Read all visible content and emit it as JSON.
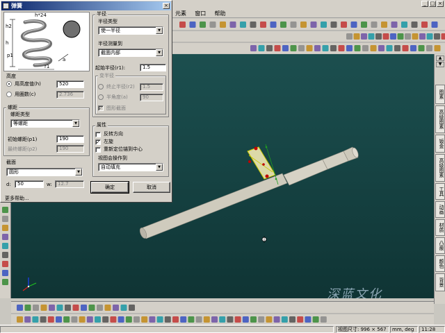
{
  "app": {
    "menus": [
      "元素",
      "窗口",
      "帮助"
    ],
    "status": {
      "coords_prefix": "视图尺寸:",
      "coords_value": "996 × 567",
      "units": "mm, deg",
      "time": "11:28"
    },
    "right_tabs": [
      "图素",
      "高级图素",
      "钣金",
      "高级图素",
      "工具",
      "动画",
      "材质",
      "凸痕",
      "颜色",
      "背景"
    ],
    "watermark": "深蓝文化"
  },
  "dialog": {
    "title": "弹簧",
    "height_section": {
      "label": "高度",
      "option_height": "用高度值(h)",
      "option_turns": "用圈数(c)",
      "height_value": "520",
      "turns_value": "2.736"
    },
    "pitch_section": {
      "label": "螺距",
      "type_label": "螺距类型",
      "type_value": "等螺距",
      "initial_label": "初始螺距(p1)",
      "initial_value": "190",
      "final_label": "最终螺距(p2)",
      "final_value": "190"
    },
    "section_group": {
      "label": "截面",
      "shape_value": "圆形",
      "d_label": "d:",
      "d_value": "50",
      "w_label": "w:",
      "w_value": "12.7"
    },
    "more": "更多帮助...",
    "radius_section": {
      "label": "半径",
      "type_label": "半径类型",
      "type_value": "使一半径",
      "measure_label": "半径测量到",
      "measure_value": "截面内部",
      "start_label": "起始半径(r1):",
      "start_value": "1.5",
      "var_label": "变半径",
      "end_label": "终止半径(r2)",
      "end_value": "1.5",
      "angle_label": "半角度(a)",
      "angle_value": "90",
      "draw_label": "图形截面"
    },
    "props_section": {
      "label": "属性",
      "reverse": "反转方向",
      "left_hand": "左旋",
      "relocate": "重新定位锚到中心",
      "op_label": "视图会操作到",
      "op_value": "自动填充"
    },
    "ok": "确定",
    "cancel": "取消",
    "diagram_labels": {
      "h": "h",
      "r1": "r1",
      "h2": "h2",
      "p1": "p1",
      "a": "a",
      "top": "h*24"
    }
  },
  "colors": {
    "viewport": "#174545",
    "title_bar": "#0a246a",
    "rod": "#cfcbbd"
  }
}
